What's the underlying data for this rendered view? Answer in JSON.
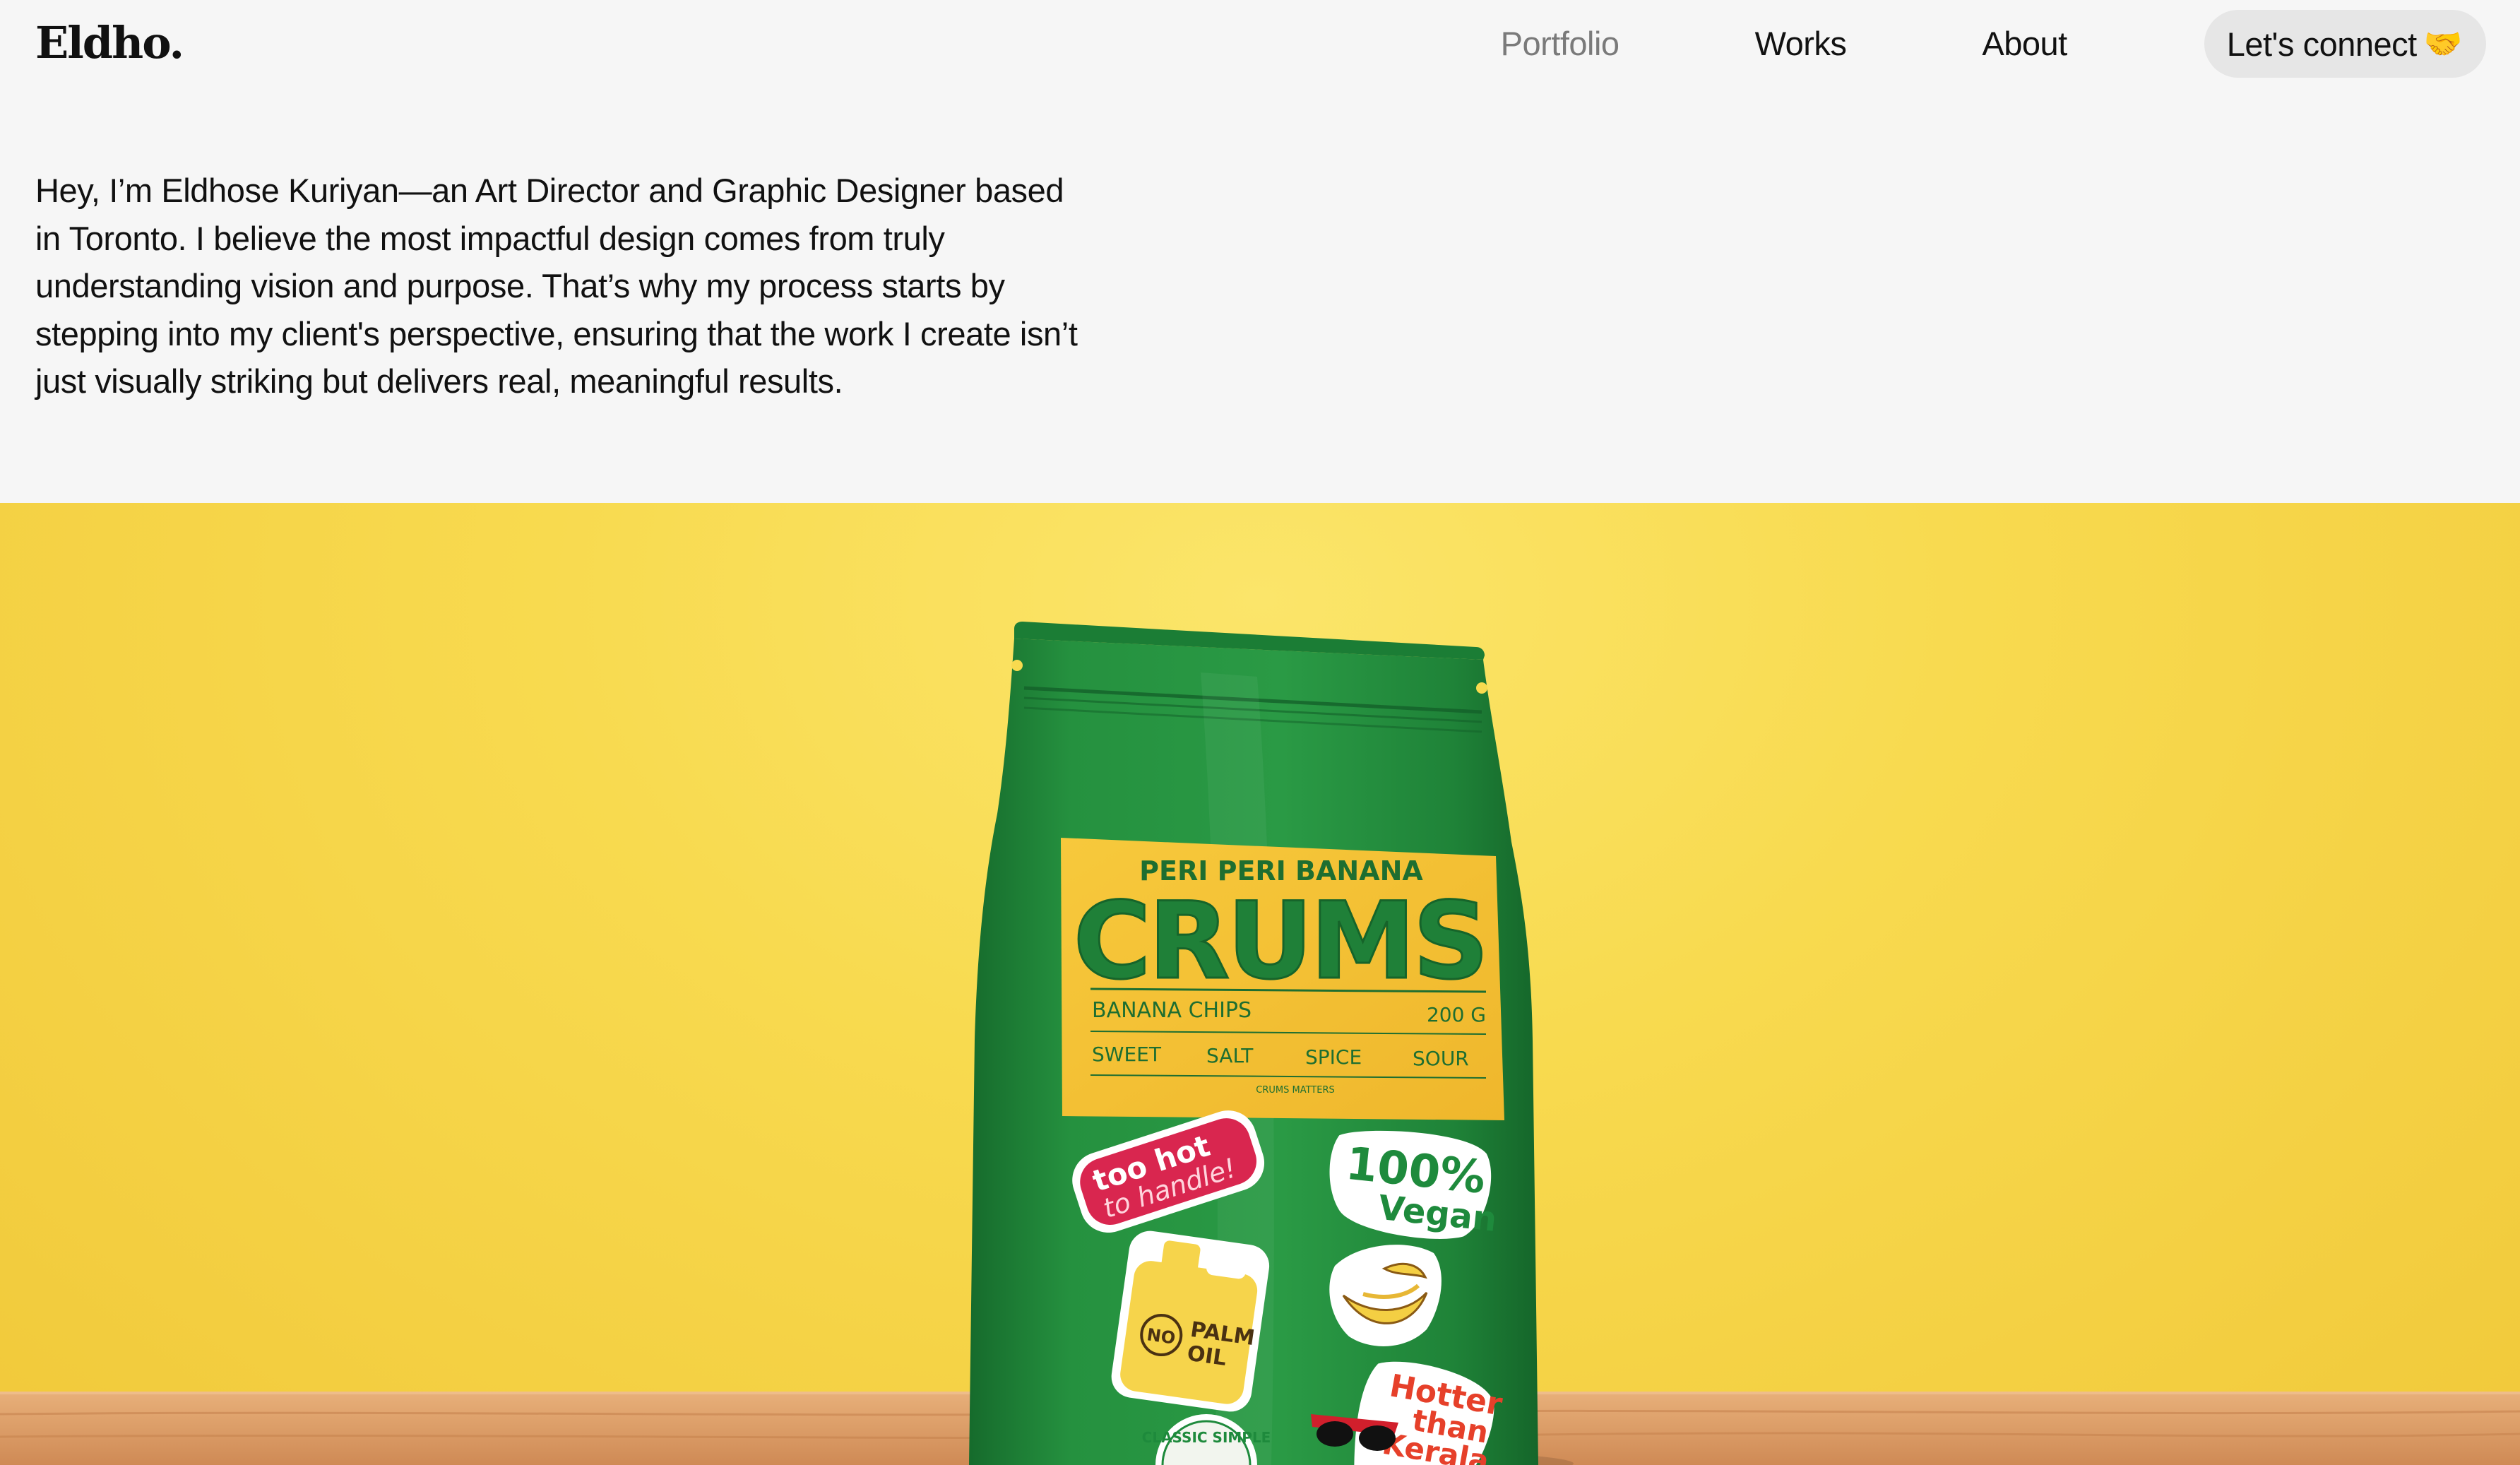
{
  "header": {
    "logo": "Eldho.",
    "nav": {
      "portfolio": "Portfolio",
      "works": "Works",
      "about": "About"
    },
    "cta": {
      "label": "Let's connect",
      "icon": "handshake-icon"
    }
  },
  "intro": {
    "text": "Hey, I’m Eldhose Kuriyan—an Art Director and Graphic Designer based in Toronto. I believe the most impactful design comes from truly understanding vision and purpose. That’s why my process starts by stepping into my client's perspective, ensuring that the work I create isn’t just visually striking but delivers real, meaningful results."
  },
  "hero": {
    "product": {
      "flavor": "PERI PERI BANANA",
      "brand": "CRUMS",
      "type": "BANANA CHIPS",
      "weight": "200 G",
      "sweet": "SWEET",
      "salt": "SALT",
      "spice": "SPICE",
      "sour": "SOUR",
      "footer": "CRUMS MATTERS"
    },
    "stickers": {
      "hot_line1": "too hot",
      "hot_line2": "to handle!",
      "vegan_line1": "100%",
      "vegan_line2": "Vegan",
      "oil_no": "NO",
      "oil_line1": "PALM",
      "oil_line2": "OIL",
      "hotter_line1": "Hotter",
      "hotter_line2": "than",
      "hotter_line3": "Kerala",
      "classic": "CLASSIC SIMPLE"
    },
    "colors": {
      "background": "#f8da4f",
      "bag": "#1f8a3a",
      "label": "#f4c234",
      "table": "#d99a64"
    }
  }
}
